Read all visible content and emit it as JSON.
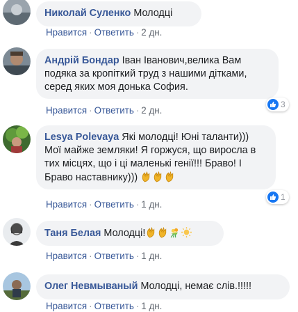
{
  "comments": [
    {
      "author": "Николай Суленко",
      "text": "Молодці",
      "actions": {
        "like": "Нравится",
        "reply": "Ответить",
        "time": "2 дн."
      },
      "reactions": null
    },
    {
      "author": "Андрій Бондар",
      "text": "Іван Іванович,велика Вам подяка за кропіткий труд з нашими дітками, серед яких моя донька София.",
      "actions": {
        "like": "Нравится",
        "reply": "Ответить",
        "time": "2 дн."
      },
      "reactions": {
        "count": "3",
        "icon": "like-icon"
      }
    },
    {
      "author": "Lesya Polevaya",
      "text": "Які молодці! Юні таланти))) Мої майже земляки! Я горжуся, що виросла в тих місцях, що і ці маленькі генії!!! Браво! І Браво наставнику)))",
      "actions": {
        "like": "Нравится",
        "reply": "Ответить",
        "time": "1 дн."
      },
      "reactions": {
        "count": "1",
        "icon": "like-icon"
      },
      "emojis": [
        "clapping-hands",
        "clapping-hands",
        "clapping-hands"
      ]
    },
    {
      "author": "Таня Белая",
      "text": "Молодці!",
      "actions": {
        "like": "Нравится",
        "reply": "Ответить",
        "time": "1 дн."
      },
      "reactions": null,
      "emojis": [
        "clapping-hands",
        "clapping-hands",
        "bouquet",
        "sun"
      ]
    },
    {
      "author": "Олег Невмываный",
      "text": "Молодці, немає слів.!!!!!",
      "actions": {
        "like": "Нравится",
        "reply": "Ответить",
        "time": "1 дн."
      },
      "reactions": null
    }
  ],
  "colors": {
    "author": "#385898",
    "bubble": "#f2f3f5",
    "like_badge": "#1877f2",
    "meta": "#616770"
  }
}
